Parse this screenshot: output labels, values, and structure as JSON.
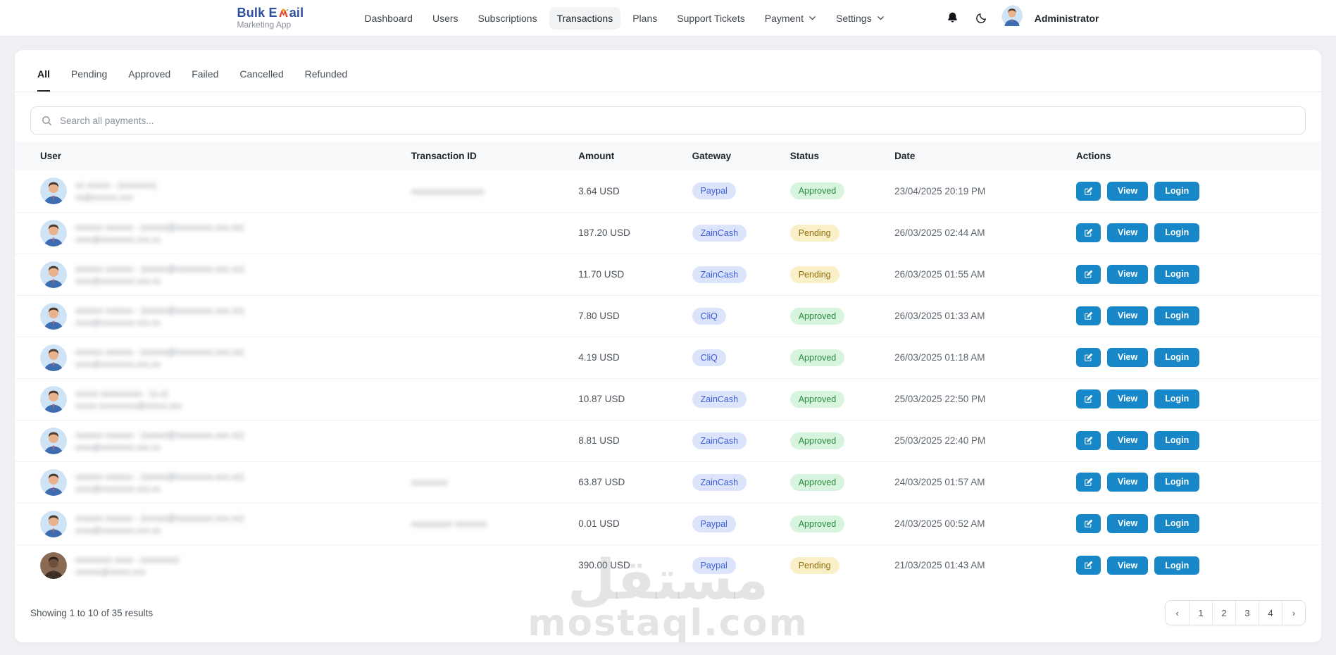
{
  "navbar": {
    "logo": {
      "line1_a": "Bulk E",
      "line1_b": "ail",
      "line2": "Marketing App",
      "icon": "multicolor-m-icon"
    },
    "items": [
      {
        "label": "Dashboard",
        "active": false,
        "caret": false
      },
      {
        "label": "Users",
        "active": false,
        "caret": false
      },
      {
        "label": "Subscriptions",
        "active": false,
        "caret": false
      },
      {
        "label": "Transactions",
        "active": true,
        "caret": false
      },
      {
        "label": "Plans",
        "active": false,
        "caret": false
      },
      {
        "label": "Support Tickets",
        "active": false,
        "caret": false
      },
      {
        "label": "Payment",
        "active": false,
        "caret": true
      },
      {
        "label": "Settings",
        "active": false,
        "caret": true
      }
    ],
    "icons": [
      "bell-icon",
      "moon-icon"
    ],
    "user": {
      "name": "Administrator"
    }
  },
  "tabs": [
    {
      "label": "All",
      "active": true
    },
    {
      "label": "Pending",
      "active": false
    },
    {
      "label": "Approved",
      "active": false
    },
    {
      "label": "Failed",
      "active": false
    },
    {
      "label": "Cancelled",
      "active": false
    },
    {
      "label": "Refunded",
      "active": false
    }
  ],
  "search": {
    "placeholder": "Search all payments...",
    "icon": "search-icon"
  },
  "table": {
    "columns": [
      "User",
      "Transaction ID",
      "Amount",
      "Gateway",
      "Status",
      "Date",
      "Actions"
    ],
    "actions": {
      "edit_icon": "edit-icon",
      "view": "View",
      "login": "Login"
    },
    "rows": [
      {
        "name_blur": "xx xxxxx - (xxxxxxx)",
        "email_blur": "xx@xxxxxx.xxx",
        "txid_blur": "xxxxxxxxxxxxxxxx",
        "amount": "3.64 USD",
        "gateway": "Paypal",
        "status": "Approved",
        "date": "23/04/2025 20:19 PM",
        "avatar": "blue"
      },
      {
        "name_blur": "xxxxxx xxxxxx - (xxxxx@xxxxxxxx.xxx.xx)",
        "email_blur": "xxxx@xxxxxxxx.xxx.xx",
        "txid_blur": "",
        "amount": "187.20 USD",
        "gateway": "ZainCash",
        "status": "Pending",
        "date": "26/03/2025 02:44 AM",
        "avatar": "blue"
      },
      {
        "name_blur": "xxxxxx xxxxxx - (xxxxx@xxxxxxxx.xxx.xx)",
        "email_blur": "xxxx@xxxxxxxx.xxx.xx",
        "txid_blur": "",
        "amount": "11.70 USD",
        "gateway": "ZainCash",
        "status": "Pending",
        "date": "26/03/2025 01:55 AM",
        "avatar": "blue"
      },
      {
        "name_blur": "xxxxxx xxxxxx - (xxxxx@xxxxxxxx.xxx.xx)",
        "email_blur": "xxxx@xxxxxxxx.xxx.xx",
        "txid_blur": "",
        "amount": "7.80 USD",
        "gateway": "CliQ",
        "status": "Approved",
        "date": "26/03/2025 01:33 AM",
        "avatar": "blue"
      },
      {
        "name_blur": "xxxxxx xxxxxx - (xxxxx@xxxxxxxx.xxx.xx)",
        "email_blur": "xxxx@xxxxxxxx.xxx.xx",
        "txid_blur": "",
        "amount": "4.19 USD",
        "gateway": "CliQ",
        "status": "Approved",
        "date": "26/03/2025 01:18 AM",
        "avatar": "blue"
      },
      {
        "name_blur": "xxxxx xxxxxxxxx - (x.x)",
        "email_blur": "xxxxx.xxxxxxxxx@xxxxx.xxx",
        "txid_blur": "",
        "amount": "10.87 USD",
        "gateway": "ZainCash",
        "status": "Approved",
        "date": "25/03/2025 22:50 PM",
        "avatar": "blue"
      },
      {
        "name_blur": "xxxxxx xxxxxx - (xxxxx@xxxxxxxx.xxx.xx)",
        "email_blur": "xxxx@xxxxxxxx.xxx.xx",
        "txid_blur": "",
        "amount": "8.81 USD",
        "gateway": "ZainCash",
        "status": "Approved",
        "date": "25/03/2025 22:40 PM",
        "avatar": "blue"
      },
      {
        "name_blur": "xxxxxx xxxxxx - (xxxxx@xxxxxxxx.xxx.xx)",
        "email_blur": "xxxx@xxxxxxxx.xxx.xx",
        "txid_blur": "xxxxxxxx",
        "amount": "63.87 USD",
        "gateway": "ZainCash",
        "status": "Approved",
        "date": "24/03/2025 01:57 AM",
        "avatar": "blue"
      },
      {
        "name_blur": "xxxxxx xxxxxx - (xxxxx@xxxxxxxx.xxx.xx)",
        "email_blur": "xxxx@xxxxxxxx.xxx.xx",
        "txid_blur": "xxxxxxxxx xxxxxxx",
        "amount": "0.01 USD",
        "gateway": "Paypal",
        "status": "Approved",
        "date": "24/03/2025 00:52 AM",
        "avatar": "blue"
      },
      {
        "name_blur": "xxxxxxxx xxxx - (xxxxxxx)",
        "email_blur": "xxxxxx@xxxxx.xxx",
        "txid_blur": "",
        "amount": "390.00 USD",
        "gateway": "Paypal",
        "status": "Pending",
        "date": "21/03/2025 01:43 AM",
        "avatar": "photo"
      }
    ]
  },
  "footer": {
    "summary": "Showing 1 to 10 of 35 results",
    "pagination": {
      "prev": "‹",
      "pages": [
        "1",
        "2",
        "3",
        "4"
      ],
      "next": "›"
    }
  },
  "watermark": {
    "arabic": "مستقل",
    "latin": "mostaql.com"
  },
  "colors": {
    "accent_button": "#1787c7",
    "gateway_badge_bg": "#dce4fb",
    "gateway_badge_text": "#3d5ed9",
    "approved_bg": "#d7f5de",
    "approved_text": "#2b8a3e",
    "pending_bg": "#faf0c8",
    "pending_text": "#8f6c0a",
    "logo_blue": "#2d4f9e",
    "page_bg": "#eef0f3"
  }
}
